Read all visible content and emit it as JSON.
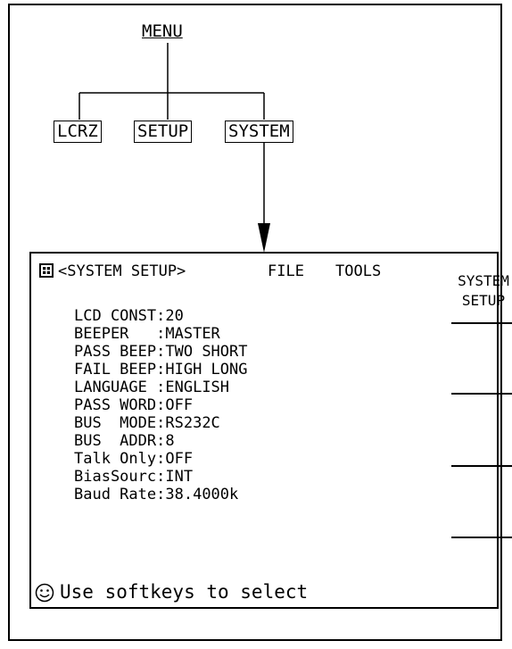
{
  "menu": {
    "title": "MENU",
    "children": [
      "LCRZ",
      "SETUP",
      "SYSTEM"
    ]
  },
  "screen": {
    "header_title": "<SYSTEM SETUP>",
    "menu_file": "FILE",
    "menu_tools": "TOOLS",
    "softkeys": [
      "SYSTEM SETUP",
      "",
      "",
      ""
    ],
    "params": [
      {
        "label": "LCD CONST",
        "value": "20"
      },
      {
        "label": "BEEPER   ",
        "value": "MASTER"
      },
      {
        "label": "PASS BEEP",
        "value": "TWO SHORT"
      },
      {
        "label": "FAIL BEEP",
        "value": "HIGH LONG"
      },
      {
        "label": "LANGUAGE ",
        "value": "ENGLISH"
      },
      {
        "label": "PASS WORD",
        "value": "OFF"
      },
      {
        "label": "BUS  MODE",
        "value": "RS232C"
      },
      {
        "label": "BUS  ADDR",
        "value": "8"
      },
      {
        "label": "Talk Only",
        "value": "OFF"
      },
      {
        "label": "BiasSourc",
        "value": "INT"
      },
      {
        "label": "Baud Rate",
        "value": "38.4000k"
      }
    ],
    "status_text": "Use softkeys to select",
    "icons": {
      "header": "disk-icon",
      "status": "smiley-icon"
    }
  }
}
